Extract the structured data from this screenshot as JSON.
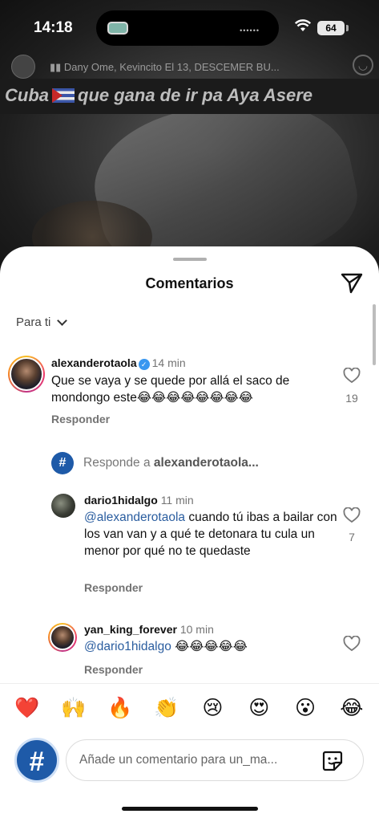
{
  "status_bar": {
    "time": "14:18",
    "battery": "64"
  },
  "video": {
    "music_text": "Dany Ome, Kevincito El 13, DESCEMER BU...",
    "caption_before_flag": "Cuba",
    "caption_after_flag": "que gana de ir pa Aya Asere"
  },
  "sheet": {
    "title": "Comentarios",
    "sort_label": "Para ti"
  },
  "comments": [
    {
      "username": "alexanderotaola",
      "verified": true,
      "time": "14 min",
      "text": "Que se vaya y se quede por allá el saco de mondongo este😂😂😂😂😂😂😂😂",
      "reply_label": "Responder",
      "likes": "19"
    }
  ],
  "reply_prompt": {
    "prefix": "Responde a ",
    "username": "alexanderotaola..."
  },
  "replies": [
    {
      "username": "dario1hidalgo",
      "time": "11 min",
      "mention": "@alexanderotaola",
      "text": " cuando tú ibas a bailar con los van van y a qué te detonara tu cula un menor por qué no te quedaste",
      "reply_label": "Responder",
      "likes": "7"
    },
    {
      "username": "yan_king_forever",
      "time": "10 min",
      "mention": "@dario1hidalgo",
      "text": " 😂😂😂😂😂",
      "reply_label": "Responder"
    }
  ],
  "emoji_bar": [
    "❤️",
    "🙌",
    "🔥",
    "👏",
    "😢",
    "😍",
    "😮",
    "😂"
  ],
  "composer": {
    "placeholder": "Añade un comentario para un_ma..."
  },
  "icons": {
    "share": "paper-plane-icon",
    "heart": "heart-outline-icon",
    "sticker": "sticker-icon",
    "avatar_logo": "hashtag-logo"
  },
  "colors": {
    "mention": "#2a5d9f",
    "verified": "#3897f0",
    "logo": "#1e5aa8"
  }
}
